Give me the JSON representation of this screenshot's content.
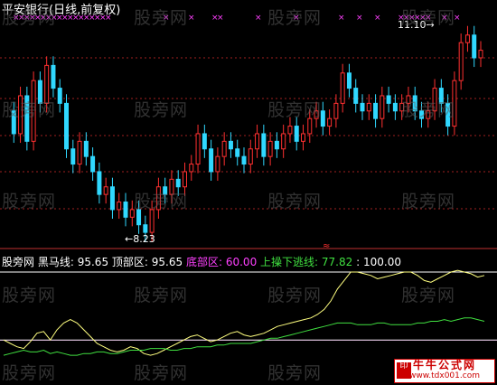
{
  "chart_data": [
    {
      "type": "candlestick",
      "title": "平安银行(日线,前复权)",
      "price_markers": {
        "high_label": "11.10",
        "low_label": "8.23"
      },
      "y_guides": [
        8.23,
        11.1
      ],
      "colors": {
        "up": "#ff3030",
        "down": "#30d8ff",
        "signal_x": "#ff40ff",
        "marker": "#ff3030"
      },
      "note_marker_symbol": "≈"
    },
    {
      "type": "line",
      "legend": {
        "name": "股旁网",
        "items": [
          {
            "label": "黑马线:",
            "value": "95.65",
            "color": "#ffffff"
          },
          {
            "label": "顶部区:",
            "value": "95.65",
            "color": "#ffffff"
          },
          {
            "label": "底部区:",
            "value": "60.00",
            "color": "#ff40ff"
          },
          {
            "label": "上操下逃线:",
            "value": "77.82",
            "color": "#40e040"
          },
          {
            "label": ":",
            "value": "100.00",
            "color": "#ffffff"
          }
        ]
      },
      "series": [
        {
          "name": "黑马线",
          "color": "#ffff80",
          "values": [
            60,
            58,
            56,
            55,
            59,
            64,
            65,
            60,
            66,
            70,
            72,
            70,
            66,
            62,
            58,
            56,
            54,
            53,
            54,
            56,
            55,
            52,
            51,
            52,
            54,
            56,
            58,
            60,
            62,
            63,
            61,
            59,
            60,
            62,
            64,
            65,
            63,
            62,
            63,
            64,
            66,
            68,
            69,
            70,
            71,
            72,
            73,
            75,
            78,
            83,
            90,
            95,
            100,
            100,
            99,
            98,
            96,
            97,
            98,
            99,
            100,
            100,
            98,
            95,
            94,
            96,
            98,
            100,
            101,
            100,
            99,
            97,
            98
          ]
        },
        {
          "name": "上操下逃线",
          "color": "#40e040",
          "values": [
            51,
            52,
            53,
            54,
            53,
            53,
            54,
            52,
            53,
            52,
            51,
            51,
            52,
            52,
            53,
            53,
            52,
            52,
            53,
            54,
            54,
            54,
            55,
            55,
            55,
            54,
            54,
            55,
            55,
            56,
            56,
            56,
            57,
            57,
            58,
            58,
            58,
            58,
            59,
            60,
            61,
            61,
            62,
            63,
            64,
            65,
            66,
            67,
            68,
            69,
            70,
            70,
            70,
            69,
            69,
            69,
            70,
            70,
            69,
            69,
            69,
            69,
            70,
            70,
            71,
            71,
            72,
            71,
            72,
            73,
            73,
            72,
            71
          ]
        }
      ]
    }
  ],
  "watermark": "股旁网",
  "logo": {
    "line1": "牛牛公式网",
    "line2": "www.tdx001.com"
  }
}
